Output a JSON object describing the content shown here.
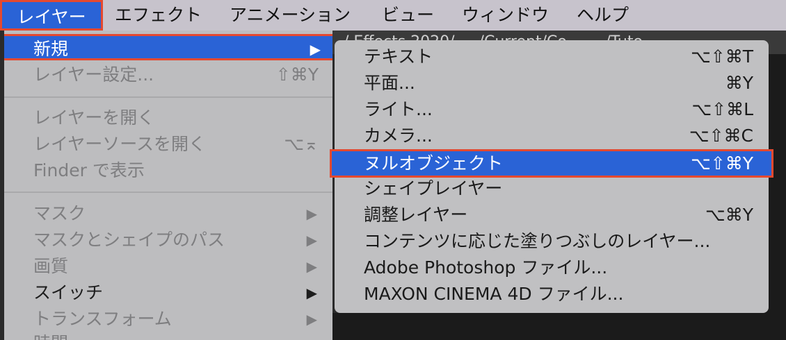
{
  "menubar": {
    "items": [
      "レイヤー",
      "エフェクト",
      "アニメーション",
      "ビュー",
      "ウィンドウ",
      "ヘルプ"
    ]
  },
  "background_path": "/ Effects 2020/ ... /Current/Co... ... /Tuto",
  "layer_menu": {
    "items": [
      {
        "label": "新規",
        "shortcut": "",
        "arrow": "▶"
      },
      {
        "label": "レイヤー設定...",
        "shortcut": "⇧⌘Y",
        "arrow": ""
      },
      {
        "label": "レイヤーを開く",
        "shortcut": "",
        "arrow": ""
      },
      {
        "label": "レイヤーソースを開く",
        "shortcut": "⌥⌅",
        "arrow": ""
      },
      {
        "label": "Finder で表示",
        "shortcut": "",
        "arrow": ""
      },
      {
        "label": "マスク",
        "shortcut": "",
        "arrow": "▶"
      },
      {
        "label": "マスクとシェイプのパス",
        "shortcut": "",
        "arrow": "▶"
      },
      {
        "label": "画質",
        "shortcut": "",
        "arrow": "▶"
      },
      {
        "label": "スイッチ",
        "shortcut": "",
        "arrow": "▶"
      },
      {
        "label": "トランスフォーム",
        "shortcut": "",
        "arrow": "▶"
      },
      {
        "label": "時間",
        "shortcut": "",
        "arrow": ""
      }
    ]
  },
  "new_submenu": {
    "items": [
      {
        "label": "テキスト",
        "shortcut": "⌥⇧⌘T"
      },
      {
        "label": "平面...",
        "shortcut": "⌘Y"
      },
      {
        "label": "ライト...",
        "shortcut": "⌥⇧⌘L"
      },
      {
        "label": "カメラ...",
        "shortcut": "⌥⇧⌘C"
      },
      {
        "label": "ヌルオブジェクト",
        "shortcut": "⌥⇧⌘Y"
      },
      {
        "label": "シェイプレイヤー",
        "shortcut": ""
      },
      {
        "label": "調整レイヤー",
        "shortcut": "⌥⌘Y"
      },
      {
        "label": "コンテンツに応じた塗りつぶしのレイヤー...",
        "shortcut": ""
      },
      {
        "label": "Adobe Photoshop ファイル...",
        "shortcut": ""
      },
      {
        "label": "MAXON CINEMA 4D ファイル...",
        "shortcut": ""
      }
    ]
  },
  "colors": {
    "highlight": "#2a63d6",
    "annotation_border": "#e5492f",
    "menu_bg": "#bdbdbf",
    "disabled_text": "#7e7e80"
  }
}
